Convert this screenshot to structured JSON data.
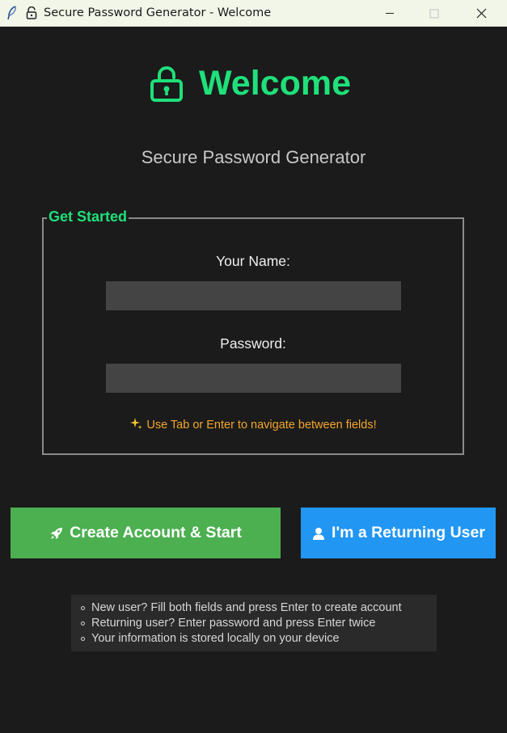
{
  "window": {
    "title": "Secure Password Generator - Welcome",
    "icons": {
      "app": "feather-icon",
      "lock": "lock-icon"
    },
    "controls": [
      "minimize-icon",
      "maximize-icon",
      "close-icon"
    ]
  },
  "hero": {
    "title": "Welcome",
    "icon": "lock-icon",
    "subtitle": "Secure Password Generator"
  },
  "form": {
    "legend": "Get Started",
    "name_label": "Your Name:",
    "name_value": "",
    "password_label": "Password:",
    "password_value": "",
    "hint": "Use Tab or Enter to navigate between fields!",
    "hint_icon": "sparkles-icon"
  },
  "actions": {
    "create_label": "Create Account & Start",
    "create_icon": "rocket-icon",
    "returning_label": "I'm a Returning User",
    "returning_icon": "user-icon"
  },
  "info": {
    "items": [
      "New user? Fill both fields and press Enter to create account",
      "Returning user? Enter password and press Enter twice",
      "Your information is stored locally on your device"
    ]
  },
  "colors": {
    "background": "#1b1b1b",
    "accent_green": "#1fe07a",
    "create_button": "#4caf50",
    "returning_button": "#2196f3",
    "hint": "#f4a62a",
    "input_bg": "#444444"
  }
}
